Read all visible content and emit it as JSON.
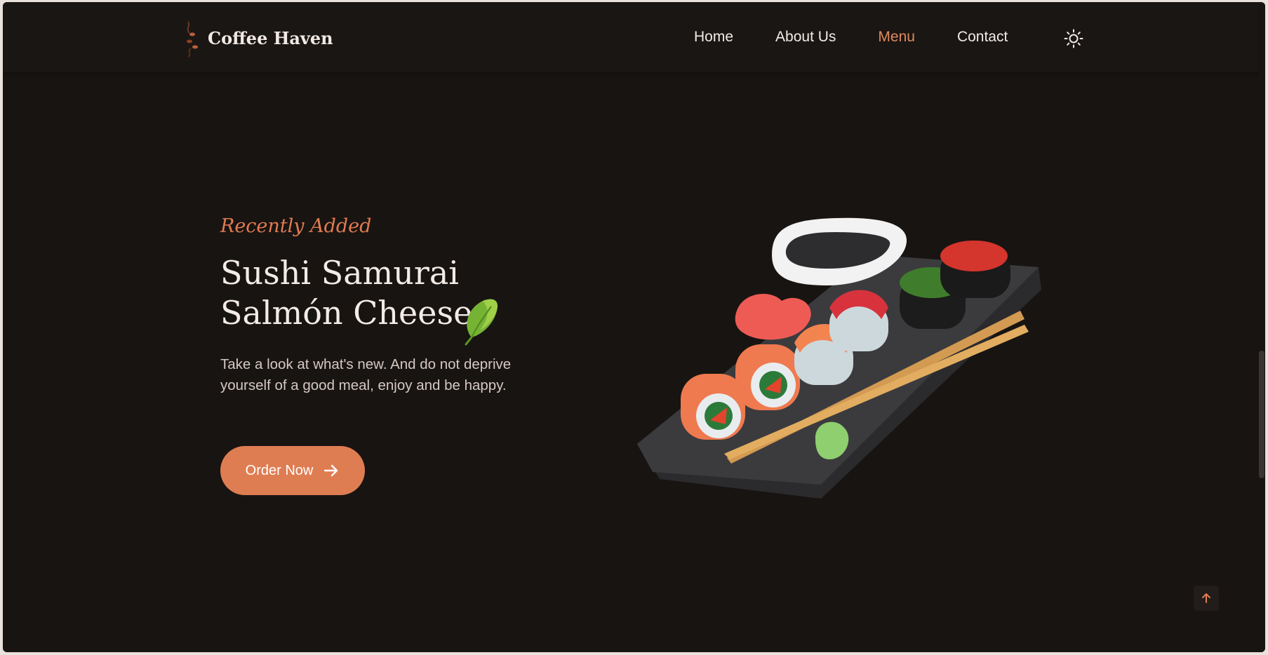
{
  "brand": {
    "name": "Coffee Haven",
    "logo_icon": "coffee-beans-logo-icon"
  },
  "nav": {
    "items": [
      {
        "label": "Home",
        "active": false
      },
      {
        "label": "About Us",
        "active": false
      },
      {
        "label": "Menu",
        "active": true
      },
      {
        "label": "Contact",
        "active": false
      }
    ],
    "theme_toggle_icon": "sun-icon"
  },
  "hero": {
    "kicker": "Recently Added",
    "title_line1": "Sushi Samurai",
    "title_line2": "Salmón Cheese",
    "description": "Take a look at what's new. And do not deprive yourself of a good meal, enjoy and be happy.",
    "cta_label": "Order Now",
    "cta_icon": "arrow-right-icon",
    "decoration_icon": "leaf-icon",
    "image_icon": "sushi-platter-image"
  },
  "back_to_top_icon": "arrow-up-icon",
  "colors": {
    "background": "#181412",
    "accent": "#df7d52",
    "text": "#f3ebe6",
    "muted": "#d4c9c2"
  }
}
